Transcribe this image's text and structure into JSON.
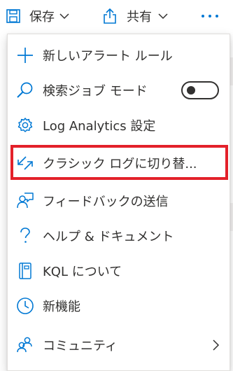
{
  "toolbar": {
    "save_label": "保存",
    "share_label": "共有",
    "save_icon": "floppy-disk-icon",
    "share_icon": "share-upload-icon",
    "more_icon": "more-ellipsis-icon"
  },
  "menu": {
    "items": [
      {
        "label": "新しいアラート ルール",
        "icon": "plus-icon"
      },
      {
        "label": "検索ジョブ モード",
        "icon": "search-icon",
        "toggle": "off"
      },
      {
        "label": "Log Analytics 設定",
        "icon": "gear-icon"
      },
      {
        "label": "クラシック ログに切り替...",
        "icon": "switch-arrows-icon",
        "highlighted": true
      },
      {
        "label": "フィードバックの送信",
        "icon": "feedback-icon"
      },
      {
        "label": "ヘルプ & ドキュメント",
        "icon": "question-icon"
      },
      {
        "label": "KQL について",
        "icon": "notebook-icon"
      },
      {
        "label": "新機能",
        "icon": "clock-icon"
      },
      {
        "label": "コミュニティ",
        "icon": "people-icon",
        "submenu": true
      }
    ]
  },
  "colors": {
    "accent": "#0078d4",
    "text": "#323130",
    "highlight_border": "#e3212a"
  }
}
